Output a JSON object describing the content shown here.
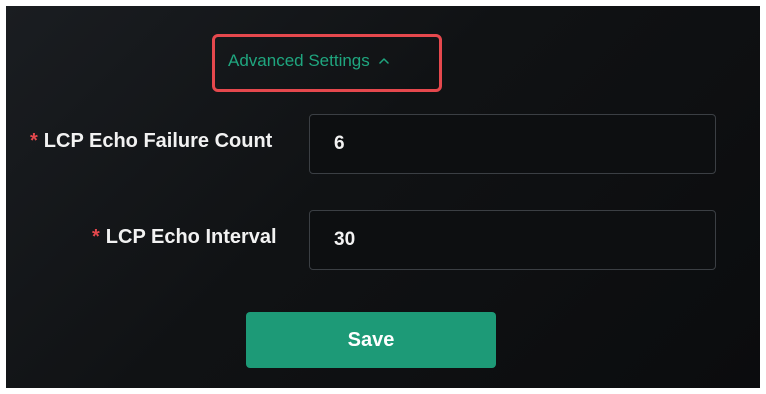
{
  "advanced_settings": {
    "label": "Advanced Settings",
    "icon": "chevron-up-icon",
    "expanded": true
  },
  "form": {
    "fields": [
      {
        "required_mark": "*",
        "label": "LCP Echo Failure Count",
        "value": "6"
      },
      {
        "required_mark": "*",
        "label": "LCP Echo Interval",
        "value": "30"
      }
    ]
  },
  "save_button": {
    "label": "Save"
  },
  "colors": {
    "accent": "#1d9a77",
    "link": "#1fa67f",
    "required": "#e5484d",
    "highlight": "#e5484d",
    "background": "#101214"
  }
}
